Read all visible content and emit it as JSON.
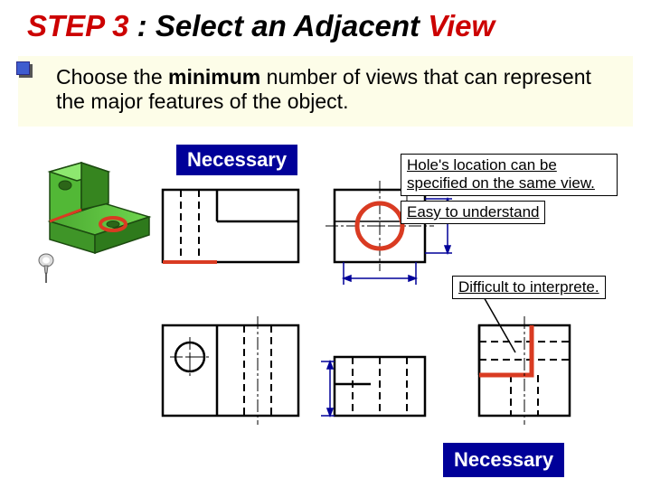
{
  "title": {
    "step": "STEP 3",
    "colon": " : ",
    "mid": "Select an Adjacent",
    "view": "  View"
  },
  "instruction": {
    "pre": "Choose the ",
    "bold": "minimum",
    "post": " number of views that can represent the major features of the object."
  },
  "labels": {
    "necessary_top": "Necessary",
    "necessary_bot": "Necessary"
  },
  "callouts": {
    "c1": "Hole's location can be specified on the same view.",
    "c2": "Easy to understand",
    "c3": "Difficult to interprete."
  }
}
